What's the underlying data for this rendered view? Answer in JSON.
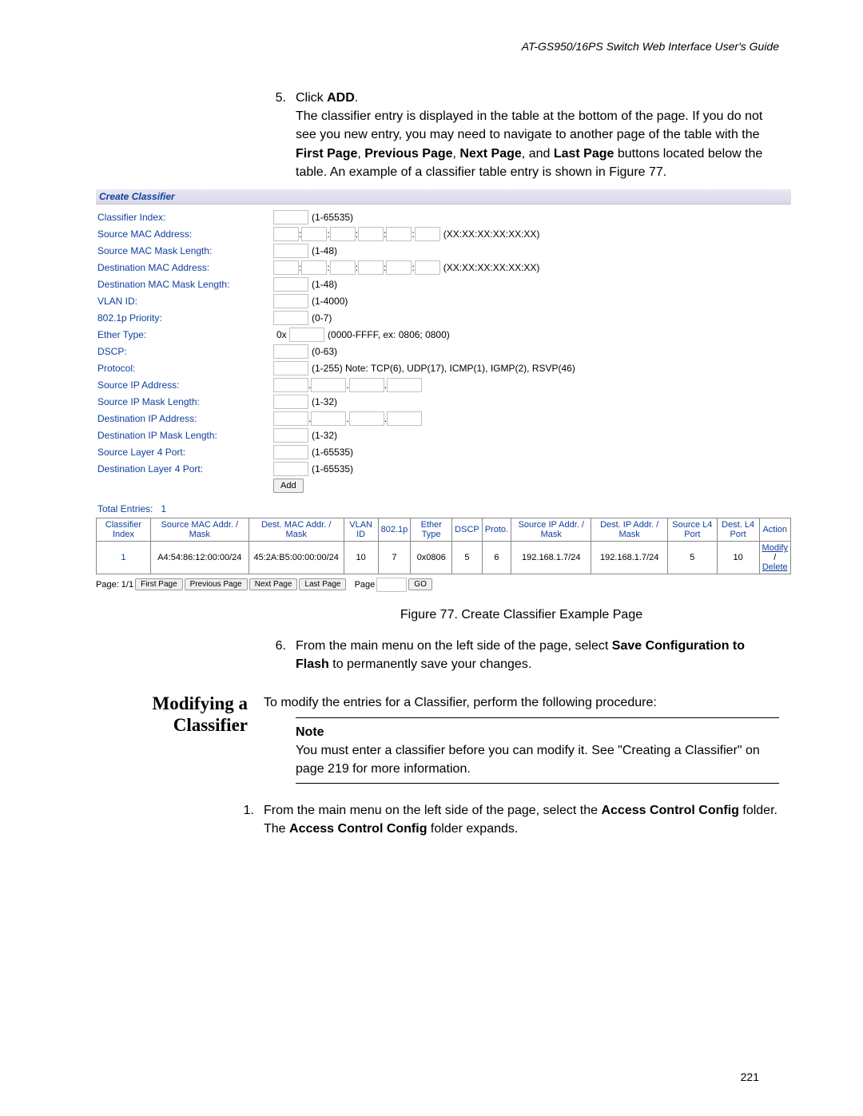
{
  "header": "AT-GS950/16PS Switch Web Interface User's Guide",
  "step5": {
    "num": "5.",
    "line1a": "Click ",
    "line1b": "ADD",
    "line1c": ".",
    "body1": "The classifier entry is displayed in the table at the bottom of the page. If you do not see you new entry, you may need to navigate to another page of the table with the ",
    "fp": "First Page",
    "c1": ", ",
    "pp": "Previous Page",
    "c2": ", ",
    "np": "Next Page",
    "c3": ", and ",
    "lp": "Last Page",
    "body2": " buttons located below the table. An example of a classifier table entry is shown in Figure 77."
  },
  "form": {
    "title": "Create Classifier",
    "rows": {
      "ci": {
        "label": "Classifier Index:",
        "hint": "(1-65535)"
      },
      "smac": {
        "label": "Source MAC Address:",
        "hint": "(XX:XX:XX:XX:XX:XX)"
      },
      "smask": {
        "label": "Source MAC Mask Length:",
        "hint": "(1-48)"
      },
      "dmac": {
        "label": "Destination MAC Address:",
        "hint": "(XX:XX:XX:XX:XX:XX)"
      },
      "dmask": {
        "label": "Destination MAC Mask Length:",
        "hint": "(1-48)"
      },
      "vlan": {
        "label": "VLAN ID:",
        "hint": "(1-4000)"
      },
      "pri": {
        "label": "802.1p Priority:",
        "hint": "(0-7)"
      },
      "eth": {
        "label": "Ether Type:",
        "prefix": "0x",
        "hint": "(0000-FFFF, ex: 0806; 0800)"
      },
      "dscp": {
        "label": "DSCP:",
        "hint": "(0-63)"
      },
      "proto": {
        "label": "Protocol:",
        "hint": "(1-255) Note: TCP(6), UDP(17), ICMP(1), IGMP(2), RSVP(46)"
      },
      "sip": {
        "label": "Source IP Address:"
      },
      "sipm": {
        "label": "Source IP Mask Length:",
        "hint": "(1-32)"
      },
      "dip": {
        "label": "Destination IP Address:"
      },
      "dipm": {
        "label": "Destination IP Mask Length:",
        "hint": "(1-32)"
      },
      "sl4": {
        "label": "Source Layer 4 Port:",
        "hint": "(1-65535)"
      },
      "dl4": {
        "label": "Destination Layer 4 Port:",
        "hint": "(1-65535)"
      }
    },
    "addBtn": "Add",
    "totalLabel": "Total Entries:",
    "totalVal": "1"
  },
  "table": {
    "headers": [
      "Classifier Index",
      "Source MAC Addr. / Mask",
      "Dest. MAC Addr. / Mask",
      "VLAN ID",
      "802.1p",
      "Ether Type",
      "DSCP",
      "Proto.",
      "Source IP Addr. / Mask",
      "Dest. IP Addr. / Mask",
      "Source L4 Port",
      "Dest. L4 Port",
      "Action"
    ],
    "row": [
      "1",
      "A4:54:86:12:00:00/24",
      "45:2A:B5:00:00:00/24",
      "10",
      "7",
      "0x0806",
      "5",
      "6",
      "192.168.1.7/24",
      "192.168.1.7/24",
      "5",
      "10"
    ],
    "actModify": "Modify",
    "actSep": "/",
    "actDelete": "Delete"
  },
  "pager": {
    "page": "Page: 1/1",
    "fp": "First Page",
    "pp": "Previous Page",
    "np": "Next Page",
    "lp": "Last Page",
    "plabel": "Page",
    "go": "GO"
  },
  "caption": "Figure 77. Create Classifier Example Page",
  "step6": {
    "num": "6.",
    "a": "From the main menu on the left side of the page, select ",
    "b": "Save Configuration to Flash",
    "c": " to permanently save your changes."
  },
  "sidehead": "Modifying a Classifier",
  "modifyIntro": "To modify the entries for a Classifier, perform the following procedure:",
  "note": {
    "label": "Note",
    "body": "You must enter a classifier before you can modify it. See \"Creating a Classifier\" on page 219 for more information."
  },
  "step1m": {
    "num": "1.",
    "a": "From the main menu on the left side of the page, select the ",
    "b": "Access Control Config",
    "c": " folder.",
    "d": "The ",
    "e": "Access Control Config",
    "f": " folder expands."
  },
  "pageNum": "221"
}
